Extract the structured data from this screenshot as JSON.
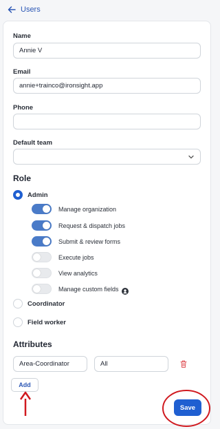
{
  "header": {
    "back_label": "Users"
  },
  "form": {
    "name": {
      "label": "Name",
      "value": "Annie V"
    },
    "email": {
      "label": "Email",
      "value": "annie+trainco@ironsight.app"
    },
    "phone": {
      "label": "Phone",
      "value": ""
    },
    "default_team": {
      "label": "Default team",
      "value": ""
    }
  },
  "role": {
    "title": "Role",
    "options": [
      {
        "label": "Admin",
        "selected": true
      },
      {
        "label": "Coordinator",
        "selected": false
      },
      {
        "label": "Field worker",
        "selected": false
      }
    ],
    "permissions": [
      {
        "label": "Manage organization",
        "enabled": true
      },
      {
        "label": "Request & dispatch jobs",
        "enabled": true
      },
      {
        "label": "Submit & review forms",
        "enabled": true
      },
      {
        "label": "Execute jobs",
        "enabled": false
      },
      {
        "label": "View analytics",
        "enabled": false
      },
      {
        "label": "Manage custom fields",
        "enabled": false
      }
    ]
  },
  "attributes": {
    "title": "Attributes",
    "rows": [
      {
        "name": "Area-Coordinator",
        "value": "All"
      }
    ],
    "add_label": "Add"
  },
  "save_label": "Save",
  "colors": {
    "primary": "#1f5fd1",
    "toggle_on": "#4a7bc8",
    "annotation": "#d0191f",
    "link": "#2b57b5"
  }
}
